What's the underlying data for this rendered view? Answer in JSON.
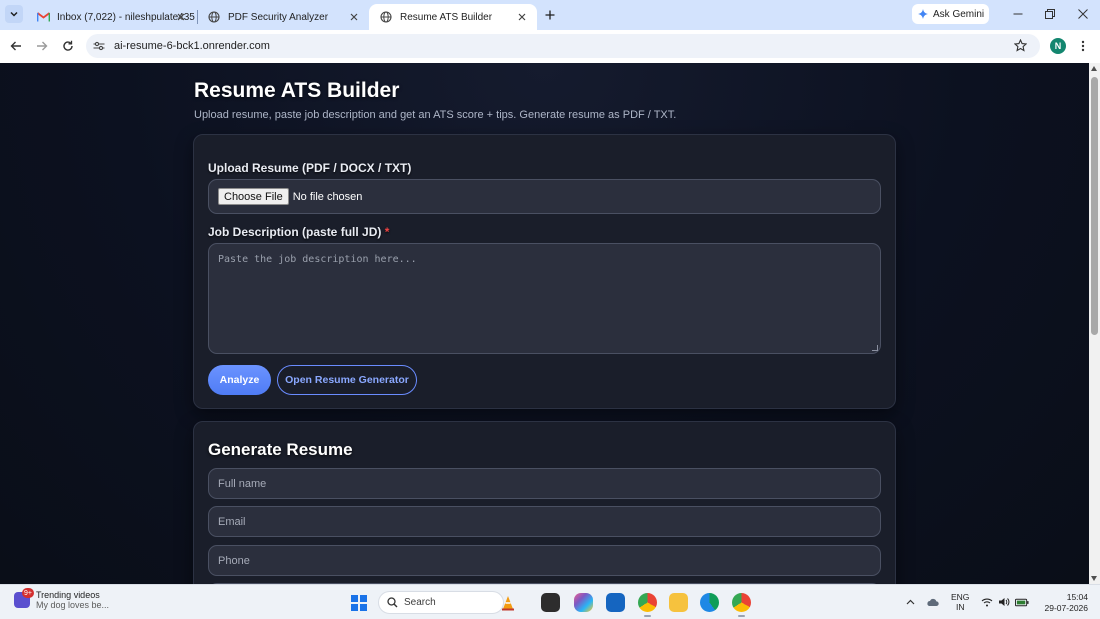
{
  "browser": {
    "tabs": [
      {
        "title": "Inbox (7,022) - nileshpulate435",
        "icon": "gmail-icon"
      },
      {
        "title": "PDF Security Analyzer",
        "icon": "globe-icon"
      },
      {
        "title": "Resume ATS Builder",
        "icon": "globe-icon",
        "active": true
      }
    ],
    "gemini_label": "Ask Gemini",
    "url": "ai-resume-6-bck1.onrender.com",
    "profile_initial": "N"
  },
  "page": {
    "title": "Resume ATS Builder",
    "subtitle": "Upload resume, paste job description and get an ATS score + tips. Generate resume as PDF / TXT.",
    "upload": {
      "label": "Upload Resume (PDF / DOCX / TXT)",
      "button_label": "Choose File",
      "status": "No file chosen"
    },
    "jd": {
      "label": "Job Description (paste full JD)",
      "required_mark": "*",
      "placeholder": "Paste the job description here..."
    },
    "buttons": {
      "analyze": "Analyze",
      "open_generator": "Open Resume Generator"
    },
    "generator": {
      "title": "Generate Resume",
      "fields": [
        {
          "placeholder": "Full name"
        },
        {
          "placeholder": "Email"
        },
        {
          "placeholder": "Phone"
        }
      ]
    },
    "colors": {
      "accent": "#5b86f7",
      "background": "#0c1120",
      "card": "#1a1e2a",
      "required": "#ef4444"
    }
  },
  "taskbar": {
    "weather_badge": "9+",
    "news_title": "Trending videos",
    "news_sub": "My dog loves be...",
    "search_label": "Search",
    "lang_1": "ENG",
    "lang_2": "IN",
    "time": "15:04",
    "date": "29-07-2026"
  }
}
